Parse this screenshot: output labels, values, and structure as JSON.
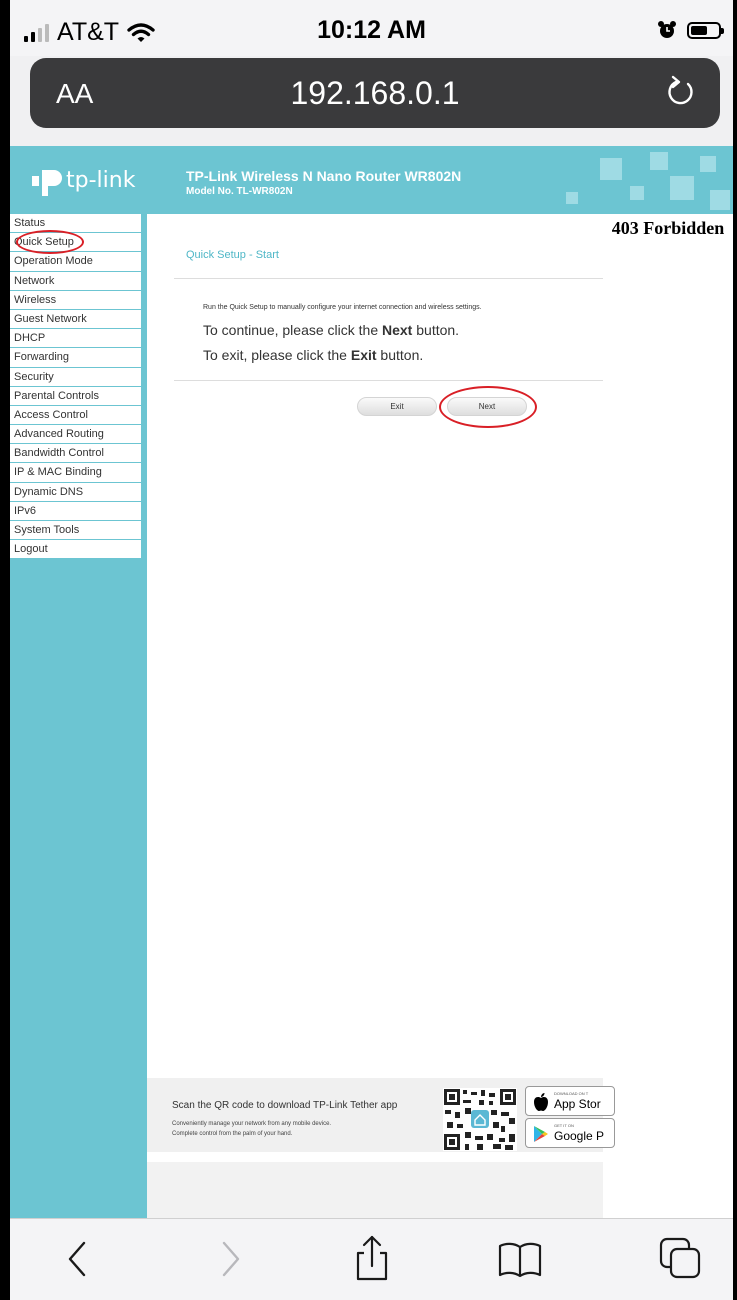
{
  "status_bar": {
    "carrier": "AT&T",
    "time": "10:12 AM"
  },
  "address_bar": {
    "text_size_control": "AA",
    "url": "192.168.0.1"
  },
  "page": {
    "logo": "tp-link",
    "header_title": "TP-Link Wireless N Nano Router WR802N",
    "header_model": "Model No. TL-WR802N",
    "menu_items": [
      "Status",
      "Quick Setup",
      "Operation Mode",
      "Network",
      "Wireless",
      "Guest Network",
      "DHCP",
      "Forwarding",
      "Security",
      "Parental Controls",
      "Access Control",
      "Advanced Routing",
      "Bandwidth Control",
      "IP & MAC Binding",
      "Dynamic DNS",
      "IPv6",
      "System Tools",
      "Logout"
    ],
    "qs_title": "Quick Setup - Start",
    "intro": "Run the Quick Setup to manually configure your internet connection and wireless settings.",
    "continue_pre": "To continue, please click the ",
    "continue_bold": "Next",
    "continue_post": " button.",
    "exit_pre": "To exit, please click the ",
    "exit_bold": "Exit",
    "exit_post": " button.",
    "exit_button": "Exit",
    "next_button": "Next",
    "forbidden": "403 Forbidden",
    "footer": {
      "main": "Scan the QR code to download TP-Link Tether app",
      "sub1": "Conveniently manage your network from any mobile device.",
      "sub2": "Complete control from the palm of your hand.",
      "appstore_small": "DOWNLOAD ON T",
      "appstore_big": "App Stor",
      "google_small": "GET IT ON",
      "google_big": "Google P"
    }
  },
  "colors": {
    "brand_teal": "#6cc5d2",
    "annotation_red": "#d91f26"
  }
}
